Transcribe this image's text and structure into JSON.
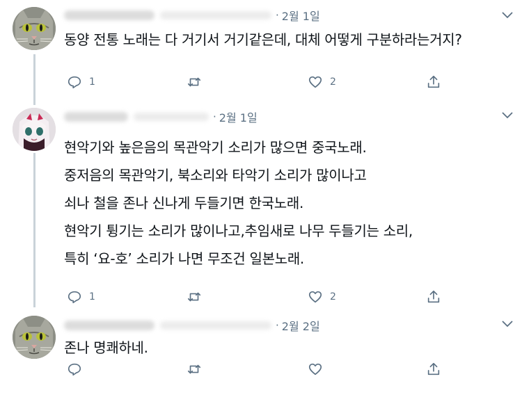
{
  "tweets": [
    {
      "name_blurred": "Jade the Scribe",
      "handle_blurred": "@JadeScribe",
      "date": "2월 1일",
      "lines": [
        "동양 전통 노래는 다 거기서 거기같은데, 대체 어떻게 구분하라는거지?"
      ],
      "reply_count": "1",
      "retweet_count": "",
      "like_count": "2",
      "avatar_icon": "cat-avatar"
    },
    {
      "name_blurred": "Metaneuk",
      "handle_blurred": "@Holy_Sick",
      "date": "2월 1일",
      "lines": [
        "현악기와 높은음의 목관악기 소리가 많으면 중국노래.",
        "중저음의 목관악기, 북소리와 타악기 소리가 많이나고",
        "쇠나 철을 존나 신나게 두들기면 한국노래.",
        "현악기 튕기는 소리가 많이나고,추임새로 나무 두들기는 소리,",
        "특히 ‘요-호’ 소리가 나면 무조건 일본노래."
      ],
      "reply_count": "1",
      "retweet_count": "",
      "like_count": "2",
      "avatar_icon": "anime-avatar"
    },
    {
      "name_blurred": "Jade the Scribe",
      "handle_blurred": "@JadeScribe",
      "date": "2월 2일",
      "lines": [
        "존나 명쾌하네."
      ],
      "reply_count": "",
      "retweet_count": "",
      "like_count": "",
      "avatar_icon": "cat-avatar"
    }
  ],
  "separator": "·",
  "colors": {
    "text": "#0f1419",
    "muted": "#5b7083",
    "thread_line": "#c9d2d9"
  }
}
